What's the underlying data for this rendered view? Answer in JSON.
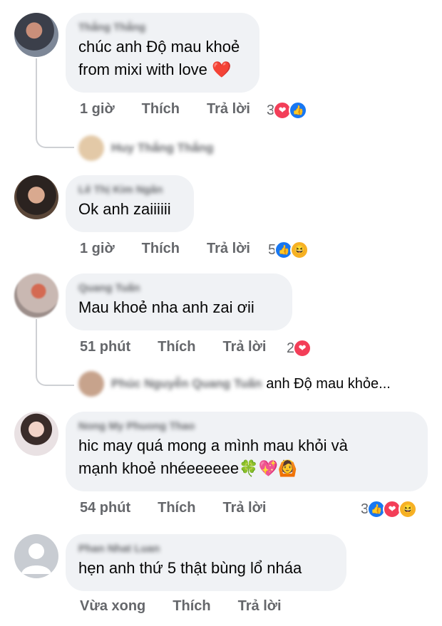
{
  "comments": [
    {
      "author": "Thắng Thắng",
      "lines": [
        "chúc anh Độ mau khoẻ",
        "from mixi with love ❤️"
      ],
      "time": "1 giờ",
      "like_label": "Thích",
      "reply_label": "Trả lời",
      "reaction_count": "3",
      "reactions": [
        "love",
        "like"
      ],
      "reply": {
        "author": "Huy Thắng Thắng",
        "text": ""
      }
    },
    {
      "author": "Lê Thị Kim Ngân",
      "lines": [
        "Ok anh zaiiiiii"
      ],
      "time": "1 giờ",
      "like_label": "Thích",
      "reply_label": "Trả lời",
      "reaction_count": "5",
      "reactions": [
        "like",
        "haha"
      ]
    },
    {
      "author": "Quang Tuấn",
      "lines": [
        "Mau khoẻ nha anh zai ơii"
      ],
      "time": "51 phút",
      "like_label": "Thích",
      "reply_label": "Trả lời",
      "reaction_count": "2",
      "reactions": [
        "love"
      ],
      "reply": {
        "author": "Phúc Nguyễn Quang Tuấn",
        "text": "anh Độ mau khỏe..."
      }
    },
    {
      "author": "Nong My Phuong Thao",
      "lines": [
        "hic may quá mong a mình mau khỏi và",
        "mạnh khoẻ nhéeeeeee🍀💖🙆"
      ],
      "time": "54 phút",
      "like_label": "Thích",
      "reply_label": "Trả lời",
      "reaction_count": "3",
      "reactions": [
        "like",
        "love",
        "haha"
      ]
    },
    {
      "author": "Phan Nhat Luan",
      "lines": [
        "hẹn anh thứ 5 thật bùng lổ nháa"
      ],
      "time": "Vừa xong",
      "like_label": "Thích",
      "reply_label": "Trả lời",
      "reaction_count": "",
      "reactions": []
    }
  ],
  "reaction_icons": {
    "like": "👍",
    "love": "❤",
    "haha": "😆"
  },
  "colors": {
    "bubble": "#f0f2f5",
    "meta": "#65676b",
    "like": "#1877f2",
    "love": "#f33e58",
    "haha": "#f7b125"
  }
}
